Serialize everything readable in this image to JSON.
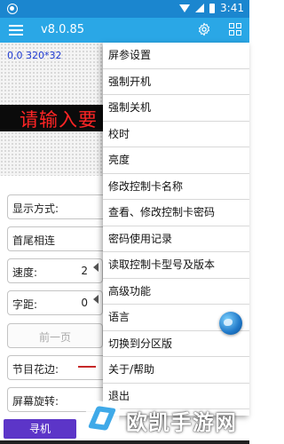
{
  "status_bar": {
    "time": "3:41"
  },
  "app_bar": {
    "title": "v8.0.85"
  },
  "preview": {
    "coord_text": "0,0 320*32",
    "led_text": "请输入要"
  },
  "settings_form": {
    "display_mode_label": "显示方式:",
    "head_tail_label": "首尾相连",
    "speed_label": "速度:",
    "speed_value": "2",
    "spacing_label": "字距:",
    "spacing_value": "0",
    "prev_page_label": "前一页",
    "border_label": "节目花边:",
    "rotation_label": "屏幕旋转:"
  },
  "search_button": {
    "label": "寻机"
  },
  "dropdown_menu": {
    "items": [
      "屏参设置",
      "强制开机",
      "强制关机",
      "校时",
      "亮度",
      "修改控制卡名称",
      "查看、修改控制卡密码",
      "密码使用记录",
      "读取控制卡型号及版本",
      "高级功能",
      "语言",
      "切换到分区版",
      "关于/帮助",
      "退出"
    ]
  },
  "watermark": {
    "text": "欧凯手游网"
  },
  "colors": {
    "app_bar": "#2aa7e6",
    "status_bar": "#1b86cf",
    "led_text": "#ff2525",
    "search_button": "#5c35c8",
    "coord_text": "#1d39d1"
  }
}
